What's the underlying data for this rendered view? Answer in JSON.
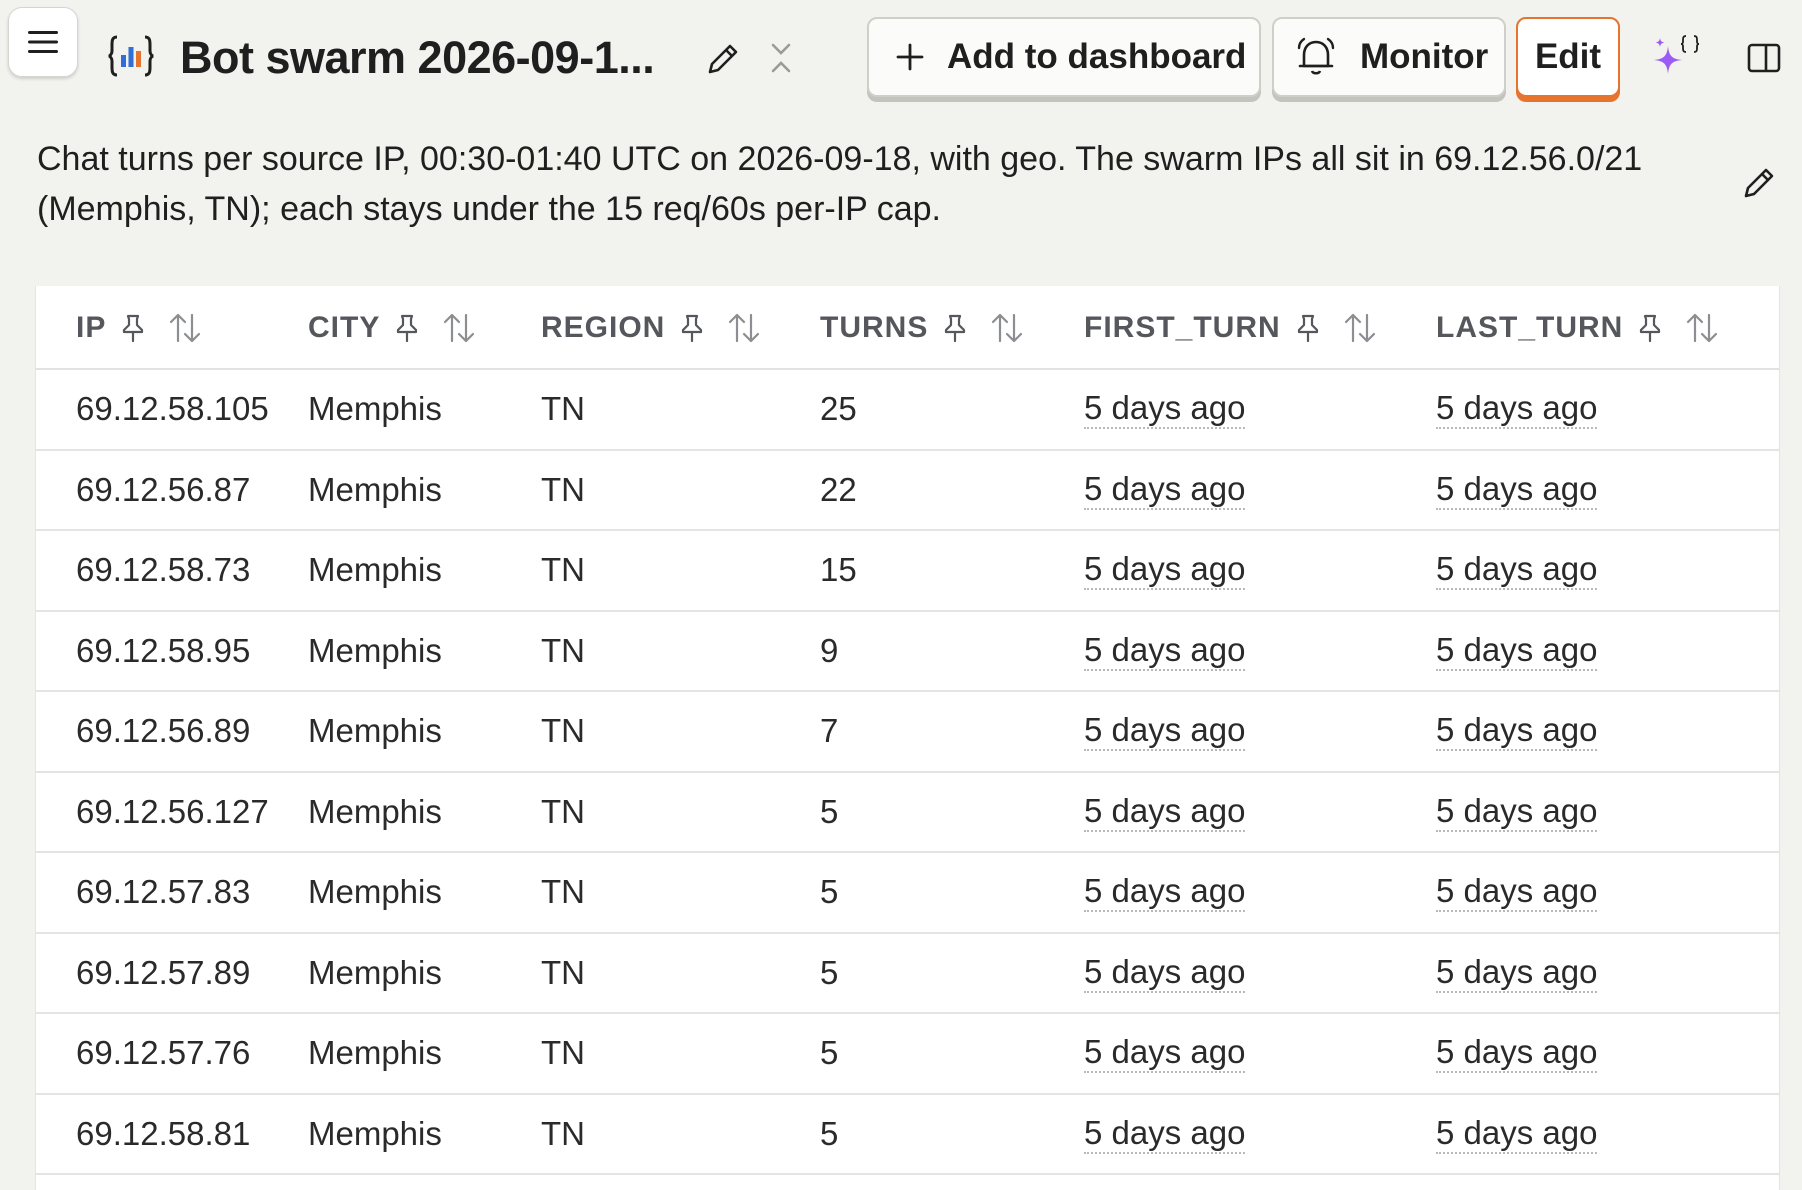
{
  "header": {
    "title": "Bot swarm 2026-09-1...",
    "buttons": {
      "add_to_dashboard": "Add to dashboard",
      "monitor": "Monitor",
      "edit": "Edit"
    }
  },
  "description": "Chat turns per source IP, 00:30-01:40 UTC on 2026-09-18, with geo. The swarm IPs all sit in 69.12.56.0/21 (Memphis, TN); each stays under the 15 req/60s per-IP cap.",
  "table": {
    "columns": [
      "IP",
      "CITY",
      "REGION",
      "TURNS",
      "FIRST_TURN",
      "LAST_TURN"
    ],
    "rows": [
      {
        "ip": "69.12.58.105",
        "city": "Memphis",
        "region": "TN",
        "turns": "25",
        "first_turn": "5 days ago",
        "last_turn": "5 days ago"
      },
      {
        "ip": "69.12.56.87",
        "city": "Memphis",
        "region": "TN",
        "turns": "22",
        "first_turn": "5 days ago",
        "last_turn": "5 days ago"
      },
      {
        "ip": "69.12.58.73",
        "city": "Memphis",
        "region": "TN",
        "turns": "15",
        "first_turn": "5 days ago",
        "last_turn": "5 days ago"
      },
      {
        "ip": "69.12.58.95",
        "city": "Memphis",
        "region": "TN",
        "turns": "9",
        "first_turn": "5 days ago",
        "last_turn": "5 days ago"
      },
      {
        "ip": "69.12.56.89",
        "city": "Memphis",
        "region": "TN",
        "turns": "7",
        "first_turn": "5 days ago",
        "last_turn": "5 days ago"
      },
      {
        "ip": "69.12.56.127",
        "city": "Memphis",
        "region": "TN",
        "turns": "5",
        "first_turn": "5 days ago",
        "last_turn": "5 days ago"
      },
      {
        "ip": "69.12.57.83",
        "city": "Memphis",
        "region": "TN",
        "turns": "5",
        "first_turn": "5 days ago",
        "last_turn": "5 days ago"
      },
      {
        "ip": "69.12.57.89",
        "city": "Memphis",
        "region": "TN",
        "turns": "5",
        "first_turn": "5 days ago",
        "last_turn": "5 days ago"
      },
      {
        "ip": "69.12.57.76",
        "city": "Memphis",
        "region": "TN",
        "turns": "5",
        "first_turn": "5 days ago",
        "last_turn": "5 days ago"
      },
      {
        "ip": "69.12.58.81",
        "city": "Memphis",
        "region": "TN",
        "turns": "5",
        "first_turn": "5 days ago",
        "last_turn": "5 days ago"
      }
    ]
  },
  "icons": {
    "menu": "hamburger-menu-icon",
    "insight": "sql-insight-icon",
    "title_edit": "pencil-icon",
    "collapse": "collapse-chevrons-icon",
    "add": "plus-icon",
    "monitor": "bell-icon",
    "ai": "sparkle-icon",
    "panel": "sidebar-panel-icon",
    "pin": "pin-icon",
    "sort": "sort-arrows-icon"
  },
  "colors": {
    "background": "#f2f2ef",
    "edit_accent": "#e6732e",
    "sparkle_purple": "#9b5cf6",
    "insight_blue": "#2f6fd6"
  }
}
